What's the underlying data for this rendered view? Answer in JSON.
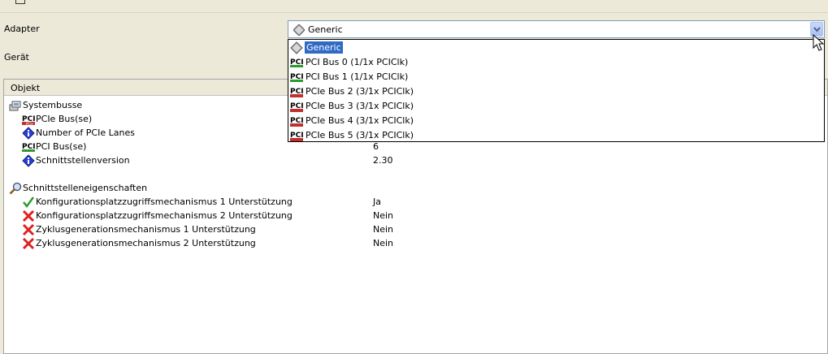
{
  "form": {
    "adapter_label": "Adapter",
    "device_label": "Gerät",
    "adapter_selected": "Generic",
    "adapter_selected_icon": "diamond-icon"
  },
  "table": {
    "column_header": "Objekt",
    "rows": [
      {
        "label": "Systembusse",
        "icon": "system-bus-icon",
        "value": ""
      },
      {
        "label": "PCIe Bus(se)",
        "icon": "pcie-icon",
        "value": ""
      },
      {
        "label": "Number of PCIe Lanes",
        "icon": "info-diamond-icon",
        "value": ""
      },
      {
        "label": "PCI Bus(se)",
        "icon": "pci-icon",
        "value": "6"
      },
      {
        "label": "Schnittstellenversion",
        "icon": "info-diamond-icon",
        "value": "2.30"
      },
      {
        "label": "Schnittstelleneigenschaften",
        "icon": "magnifier-icon",
        "value": ""
      },
      {
        "label": "Konfigurationsplatzzugriffsmechanismus 1 Unterstützung",
        "icon": "check-icon",
        "value": "Ja"
      },
      {
        "label": "Konfigurationsplatzzugriffsmechanismus 2 Unterstützung",
        "icon": "cross-icon",
        "value": "Nein"
      },
      {
        "label": "Zyklusgenerationsmechanismus 1 Unterstützung",
        "icon": "cross-icon",
        "value": "Nein"
      },
      {
        "label": "Zyklusgenerationsmechanismus 2 Unterstützung",
        "icon": "cross-icon",
        "value": "Nein"
      }
    ]
  },
  "dropdown": {
    "options": [
      {
        "label": "Generic",
        "icon": "diamond-icon",
        "selected": true
      },
      {
        "label": "PCI Bus 0 (1/1x PCIClk)",
        "icon": "pci-icon",
        "selected": false
      },
      {
        "label": "PCI Bus 1 (1/1x PCIClk)",
        "icon": "pci-icon",
        "selected": false
      },
      {
        "label": "PCIe Bus 2 (3/1x PCIClk)",
        "icon": "pcie-icon",
        "selected": false
      },
      {
        "label": "PCIe Bus 3 (3/1x PCIClk)",
        "icon": "pcie-icon",
        "selected": false
      },
      {
        "label": "PCIe Bus 4 (3/1x PCIClk)",
        "icon": "pcie-icon",
        "selected": false
      },
      {
        "label": "PCIe Bus 5 (3/1x PCIClk)",
        "icon": "pcie-icon",
        "selected": false
      }
    ]
  },
  "colors": {
    "selection": "#316ac5",
    "check": "#2e9a2e",
    "cross": "#e02020",
    "info": "#2a3fd0"
  }
}
